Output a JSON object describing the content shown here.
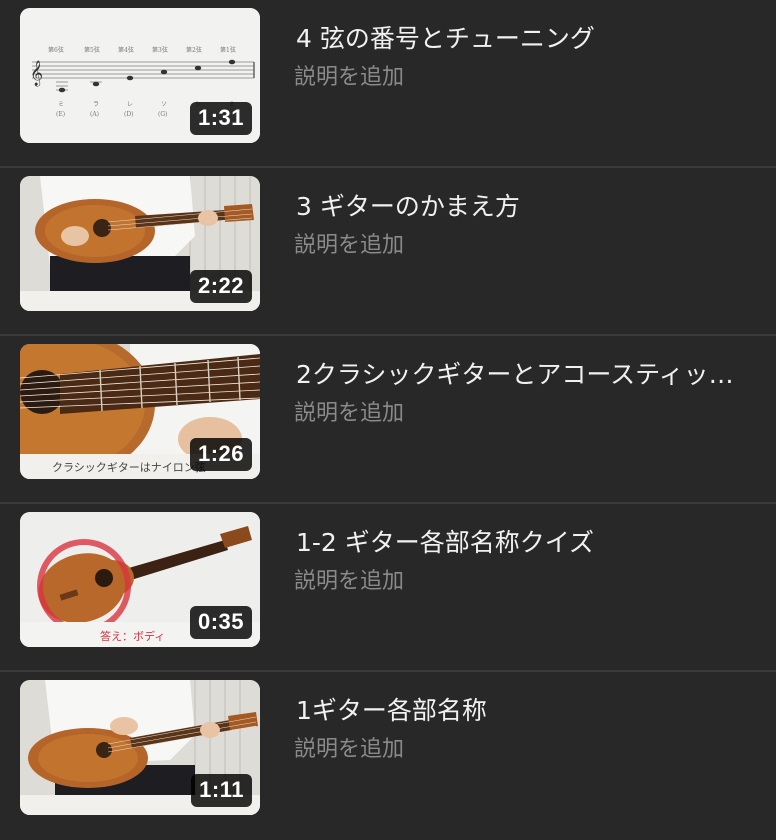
{
  "videos": [
    {
      "title": "4 弦の番号とチューニング",
      "description": "説明を追加",
      "duration": "1:31",
      "thumbnail": "staff-notation-thumbnail"
    },
    {
      "title": "3 ギターのかまえ方",
      "description": "説明を追加",
      "duration": "2:22",
      "thumbnail": "guitar-holding-thumbnail"
    },
    {
      "title": "2クラシックギターとアコースティッ…",
      "description": "説明を追加",
      "duration": "1:26",
      "thumbnail": "guitar-strings-closeup-thumbnail",
      "thumbnail_caption": "クラシックギターはナイロン弦"
    },
    {
      "title": "1-2 ギター各部名称クイズ",
      "description": "説明を追加",
      "duration": "0:35",
      "thumbnail": "guitar-quiz-thumbnail",
      "thumbnail_caption": "答え：ボディ"
    },
    {
      "title": "1ギター各部名称",
      "description": "説明を追加",
      "duration": "1:11",
      "thumbnail": "guitar-parts-thumbnail"
    }
  ],
  "colors": {
    "background": "#282828",
    "divider": "#3a3a3a",
    "title": "#f1f1f1",
    "description": "#8a8a8a",
    "quiz_circle": "#d9333f"
  }
}
